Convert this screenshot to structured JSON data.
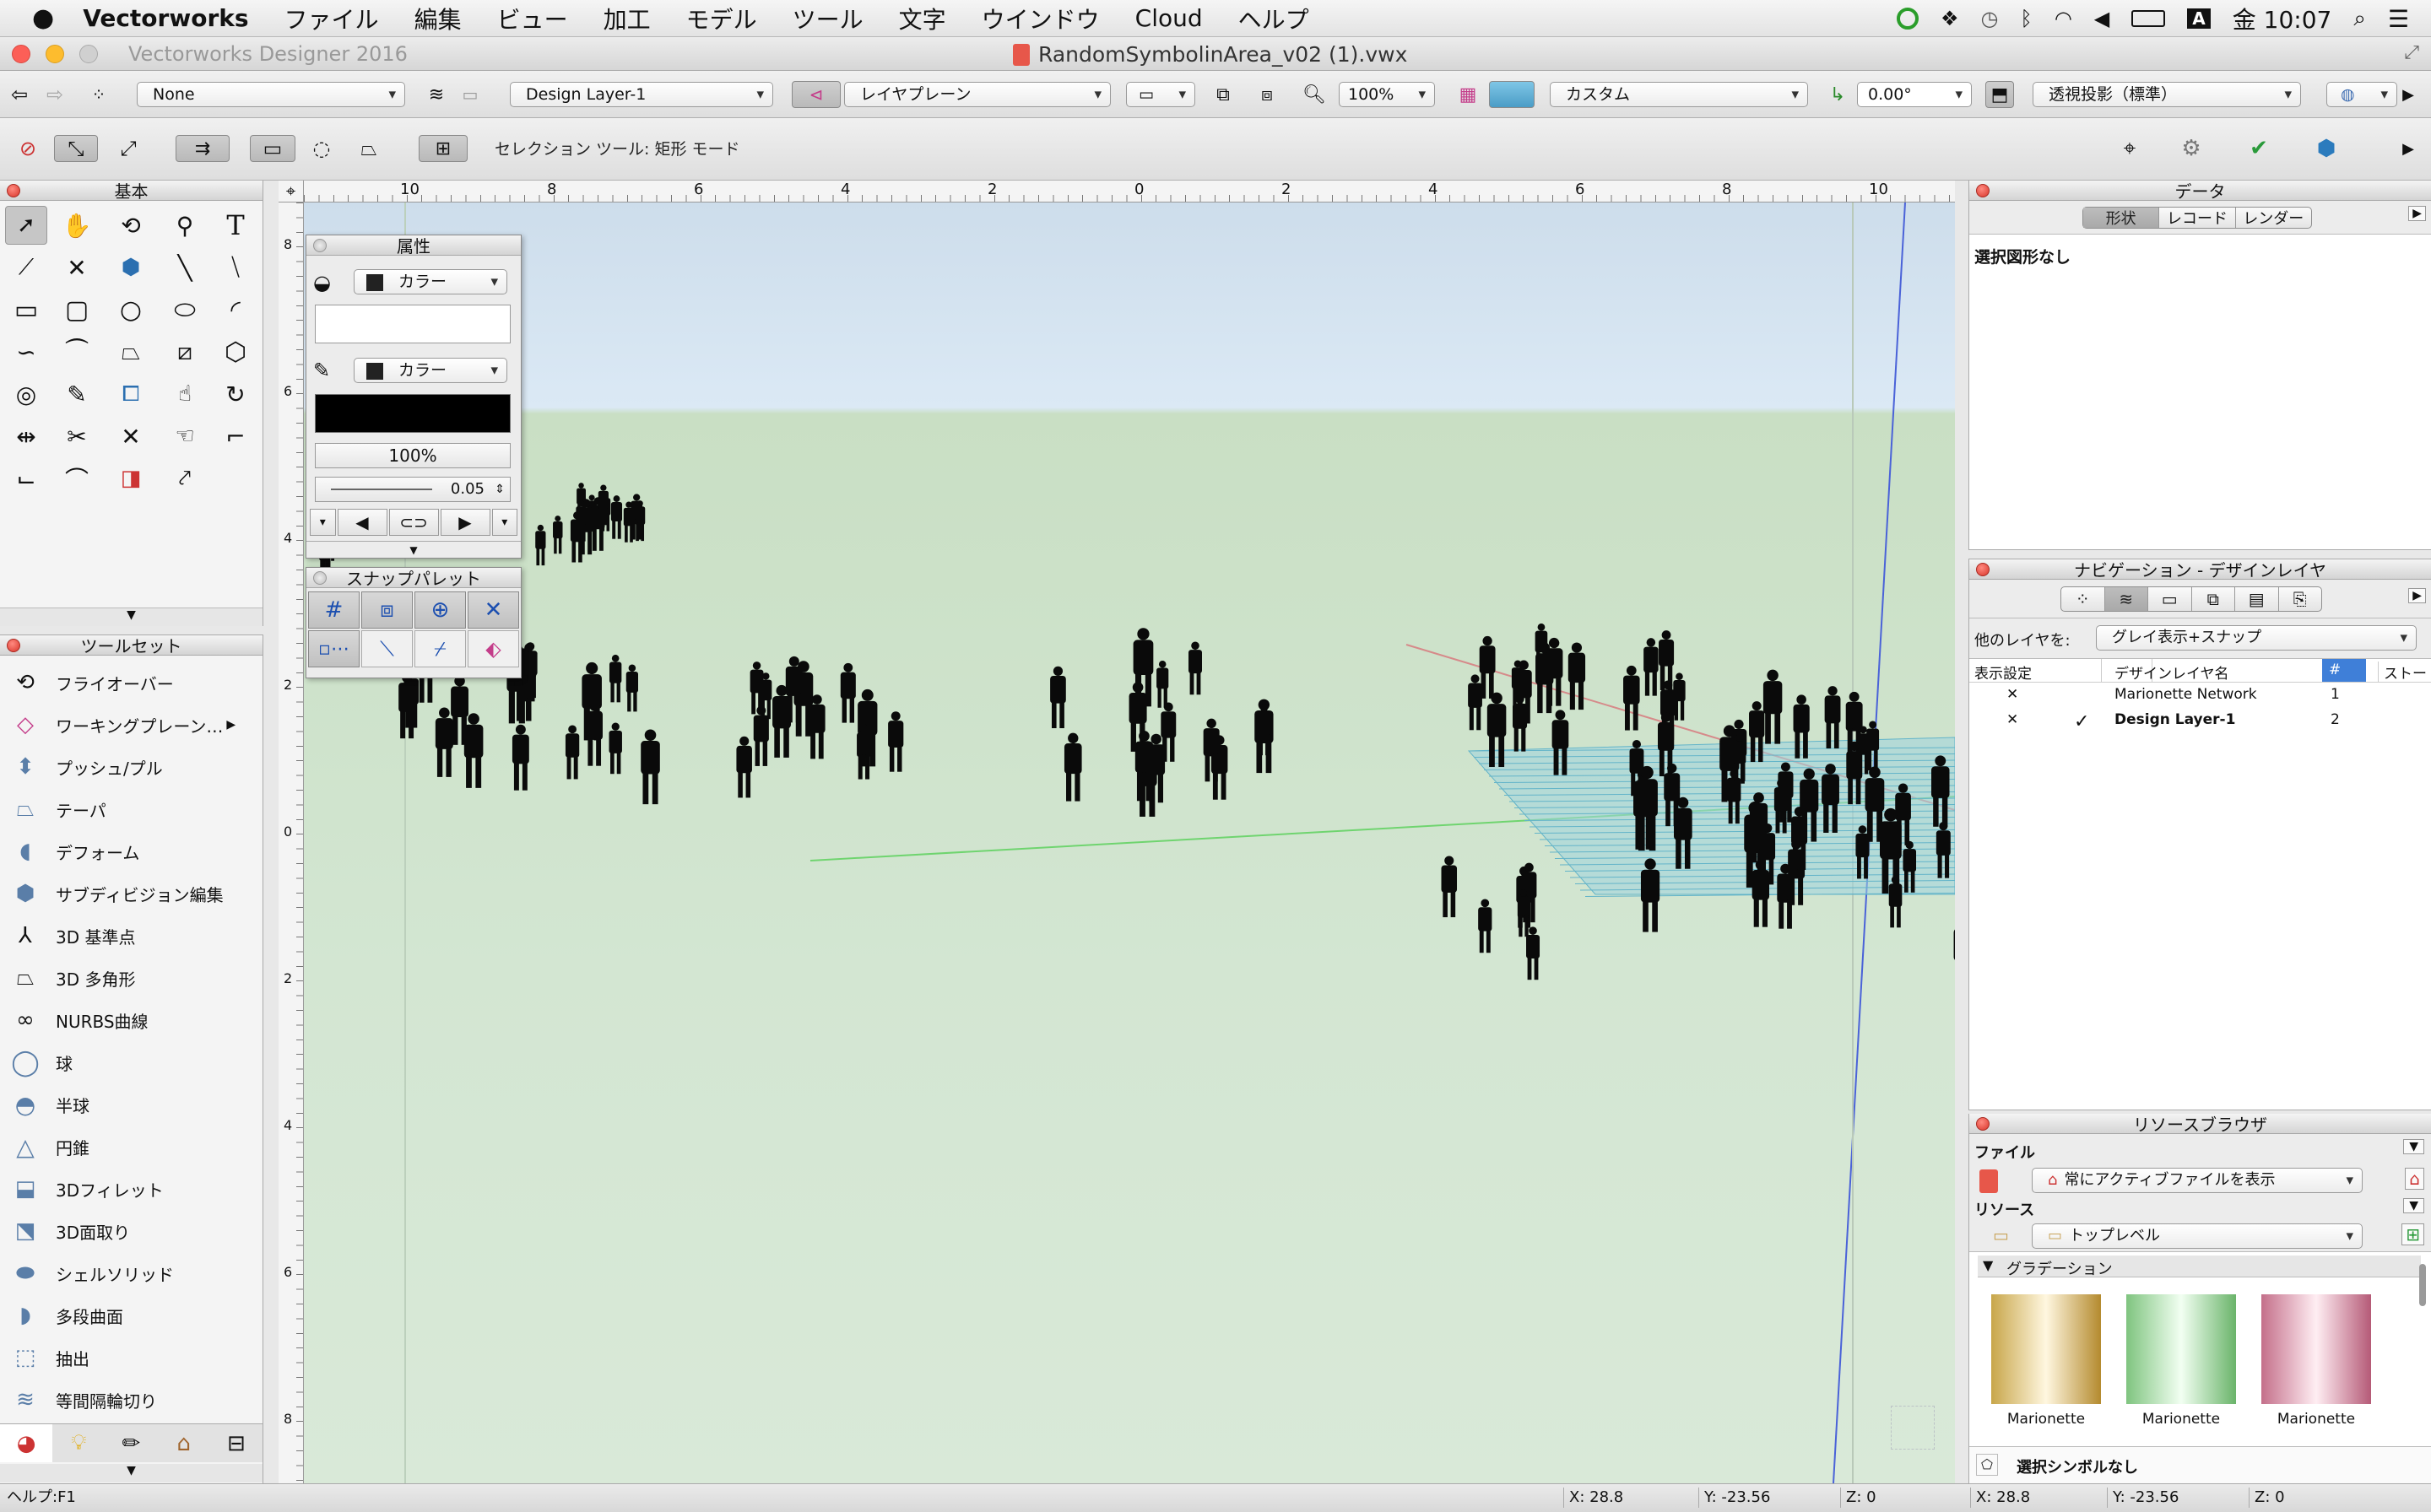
{
  "menubar": {
    "app_name": "Vectorworks",
    "menus": [
      "ファイル",
      "編集",
      "ビュー",
      "加工",
      "モデル",
      "ツール",
      "文字",
      "ウインドウ",
      "Cloud",
      "ヘルプ"
    ],
    "clock": "金 10:07",
    "input_source": "A"
  },
  "window": {
    "app_title": "Vectorworks Designer 2016",
    "doc_title": "RandomSymbolinArea_v02 (1).vwx"
  },
  "view_bar": {
    "class": "None",
    "layer": "Design Layer-1",
    "plane": "レイヤプレーン",
    "zoom": "100%",
    "render_mode": "カスタム",
    "rotation": "0.00°",
    "projection": "透視投影（標準）"
  },
  "mode_bar": {
    "hint": "セレクション ツール: 矩形 モード"
  },
  "basic_palette": {
    "title": "基本"
  },
  "toolset_palette": {
    "title": "ツールセット",
    "items": [
      "フライオーバー",
      "ワーキングプレーン…",
      "プッシュ/プル",
      "テーパ",
      "デフォーム",
      "サブディビジョン編集",
      "3D 基準点",
      "3D 多角形",
      "NURBS曲線",
      "球",
      "半球",
      "円錐",
      "3Dフィレット",
      "3D面取り",
      "シェルソリッド",
      "多段曲面",
      "抽出",
      "等間隔輪切り"
    ]
  },
  "attributes_palette": {
    "title": "属性",
    "fill_type": "カラー",
    "pen_type": "カラー",
    "opacity": "100%",
    "line_weight": "0.05"
  },
  "snap_palette": {
    "title": "スナップパレット"
  },
  "rulers": {
    "horizontal": [
      "10",
      "8",
      "6",
      "4",
      "2",
      "0",
      "2",
      "4",
      "6",
      "8",
      "10"
    ],
    "vertical": [
      "8",
      "6",
      "4",
      "2",
      "0",
      "2",
      "4",
      "6",
      "8"
    ]
  },
  "data_palette": {
    "title": "データ",
    "tabs": [
      "形状",
      "レコード",
      "レンダー"
    ],
    "active_tab": "形状",
    "empty_text": "選択図形なし"
  },
  "navigation_palette": {
    "title": "ナビゲーション - デザインレイヤ",
    "other_layers_label": "他のレイヤを:",
    "other_layers_value": "グレイ表示+スナップ",
    "columns": [
      "表示設定",
      "デザインレイヤ名",
      "#",
      "ストー"
    ],
    "rows": [
      {
        "visibility": "✕",
        "active": "",
        "name": "Marionette Network",
        "num": "1"
      },
      {
        "visibility": "✕",
        "active": "✓",
        "name": "Design Layer-1",
        "num": "2"
      }
    ]
  },
  "resource_browser": {
    "title": "リソースブラウザ",
    "file_label": "ファイル",
    "file_value": "常にアクティブファイルを表示",
    "resource_label": "リソース",
    "resource_value": "トップレベル",
    "folder": "グラデーション",
    "thumbs": [
      {
        "name": "Marionette",
        "colors": [
          "#c8a64a",
          "#fff7e0",
          "#b48a2e"
        ]
      },
      {
        "name": "Marionette",
        "colors": [
          "#7fc47f",
          "#f2fff2",
          "#6ab46a"
        ]
      },
      {
        "name": "Marionette",
        "colors": [
          "#c46f8a",
          "#ffeef3",
          "#b55a77"
        ]
      }
    ],
    "selection": "選択シンボルなし"
  },
  "statusbar": {
    "help": "ヘルプ:F1",
    "x1": "X: 28.8",
    "y1": "Y: -23.56",
    "z1": "Z: 0",
    "x2": "X: 28.8",
    "y2": "Y: -23.56",
    "z2": "Z: 0"
  }
}
